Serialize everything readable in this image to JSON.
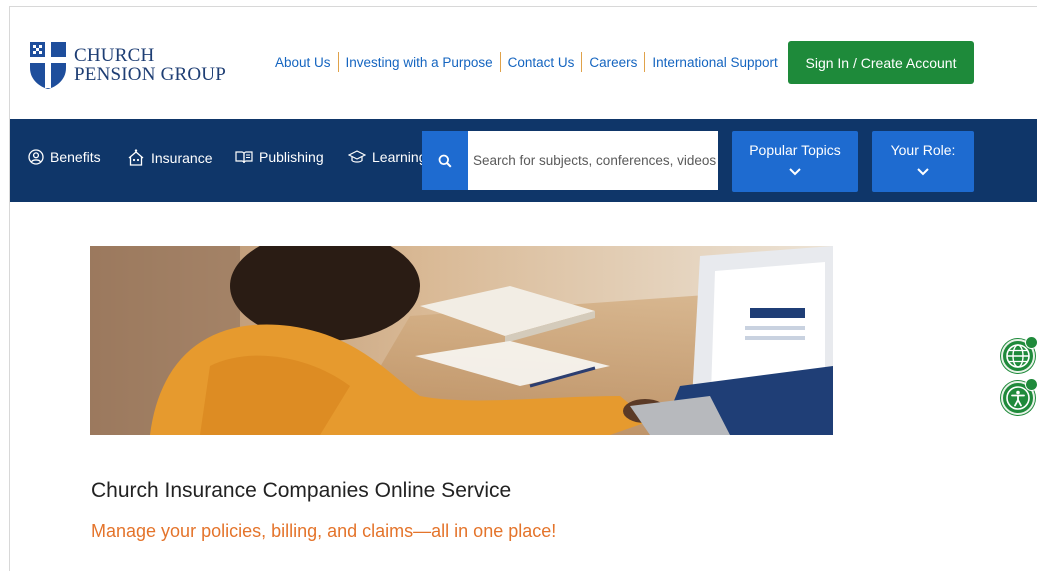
{
  "header": {
    "logo_line1": "CHURCH",
    "logo_line2": "PENSION GROUP",
    "links": [
      "About Us",
      "Investing with a Purpose",
      "Contact Us",
      "Careers",
      "International Support"
    ],
    "signin_label": "Sign In / Create Account"
  },
  "nav": {
    "items": [
      {
        "label": "Benefits",
        "icon": "person-circle-icon"
      },
      {
        "label": "Insurance",
        "icon": "house-people-icon"
      },
      {
        "label": "Publishing",
        "icon": "open-book-icon"
      },
      {
        "label": "Learning",
        "icon": "graduation-cap-icon"
      }
    ],
    "search_placeholder": "Search for subjects, conferences, videos",
    "popular_topics_label": "Popular Topics",
    "your_role_label": "Your Role:"
  },
  "main": {
    "title": "Church Insurance Companies Online Service",
    "subtitle": "Manage your policies, billing, and claims—all in one place!"
  },
  "widgets": [
    "globe-icon",
    "accessibility-icon"
  ],
  "colors": {
    "navy": "#0f3669",
    "link_blue": "#1565c0",
    "button_blue": "#1e6bd0",
    "green": "#1e8a3a",
    "orange": "#e4742b"
  }
}
